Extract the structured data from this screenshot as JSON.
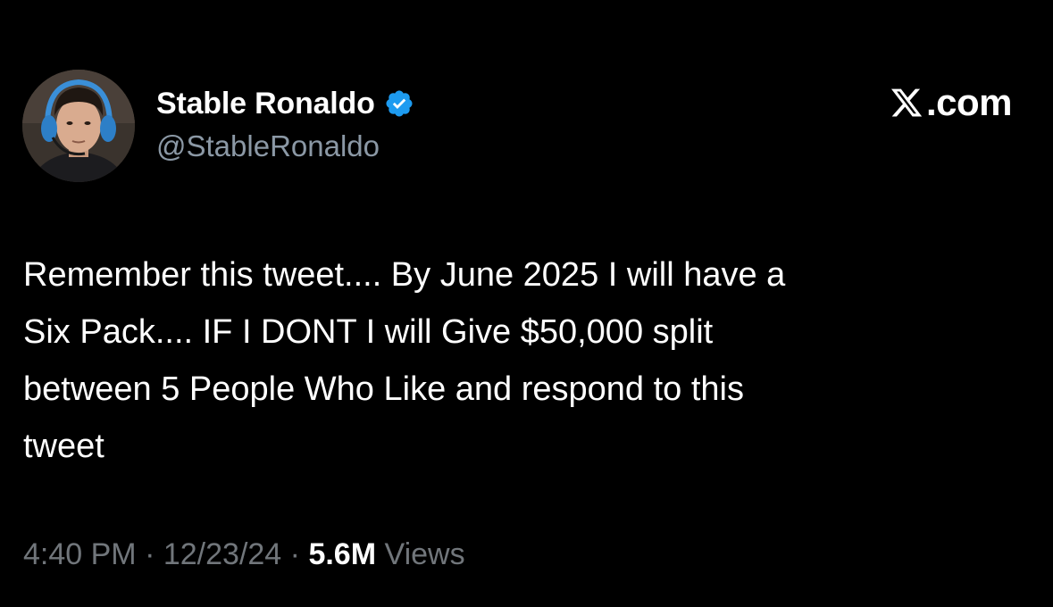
{
  "author": {
    "display_name": "Stable Ronaldo",
    "handle": "@StableRonaldo",
    "verified": true,
    "avatar_icon": "profile-photo-avatar",
    "badge_icon": "verified-badge-icon",
    "badge_color": "#1d9bf0"
  },
  "brand": {
    "icon": "x-logo-icon",
    "label": ".com"
  },
  "tweet": {
    "lines": [
      "Remember this tweet.... By June 2025 I will have a",
      "Six Pack.... IF I DONT I will Give $50,000 split",
      "between 5 People Who Like and respond to this",
      "tweet"
    ]
  },
  "meta": {
    "time": "4:40 PM",
    "separator": "·",
    "date": "12/23/24",
    "views_count": "5.6M",
    "views_label": "Views"
  },
  "colors": {
    "background": "#000000",
    "primary_text": "#ffffff",
    "secondary_text": "#8b98a5",
    "meta_text": "#71767b",
    "accent": "#1d9bf0"
  }
}
